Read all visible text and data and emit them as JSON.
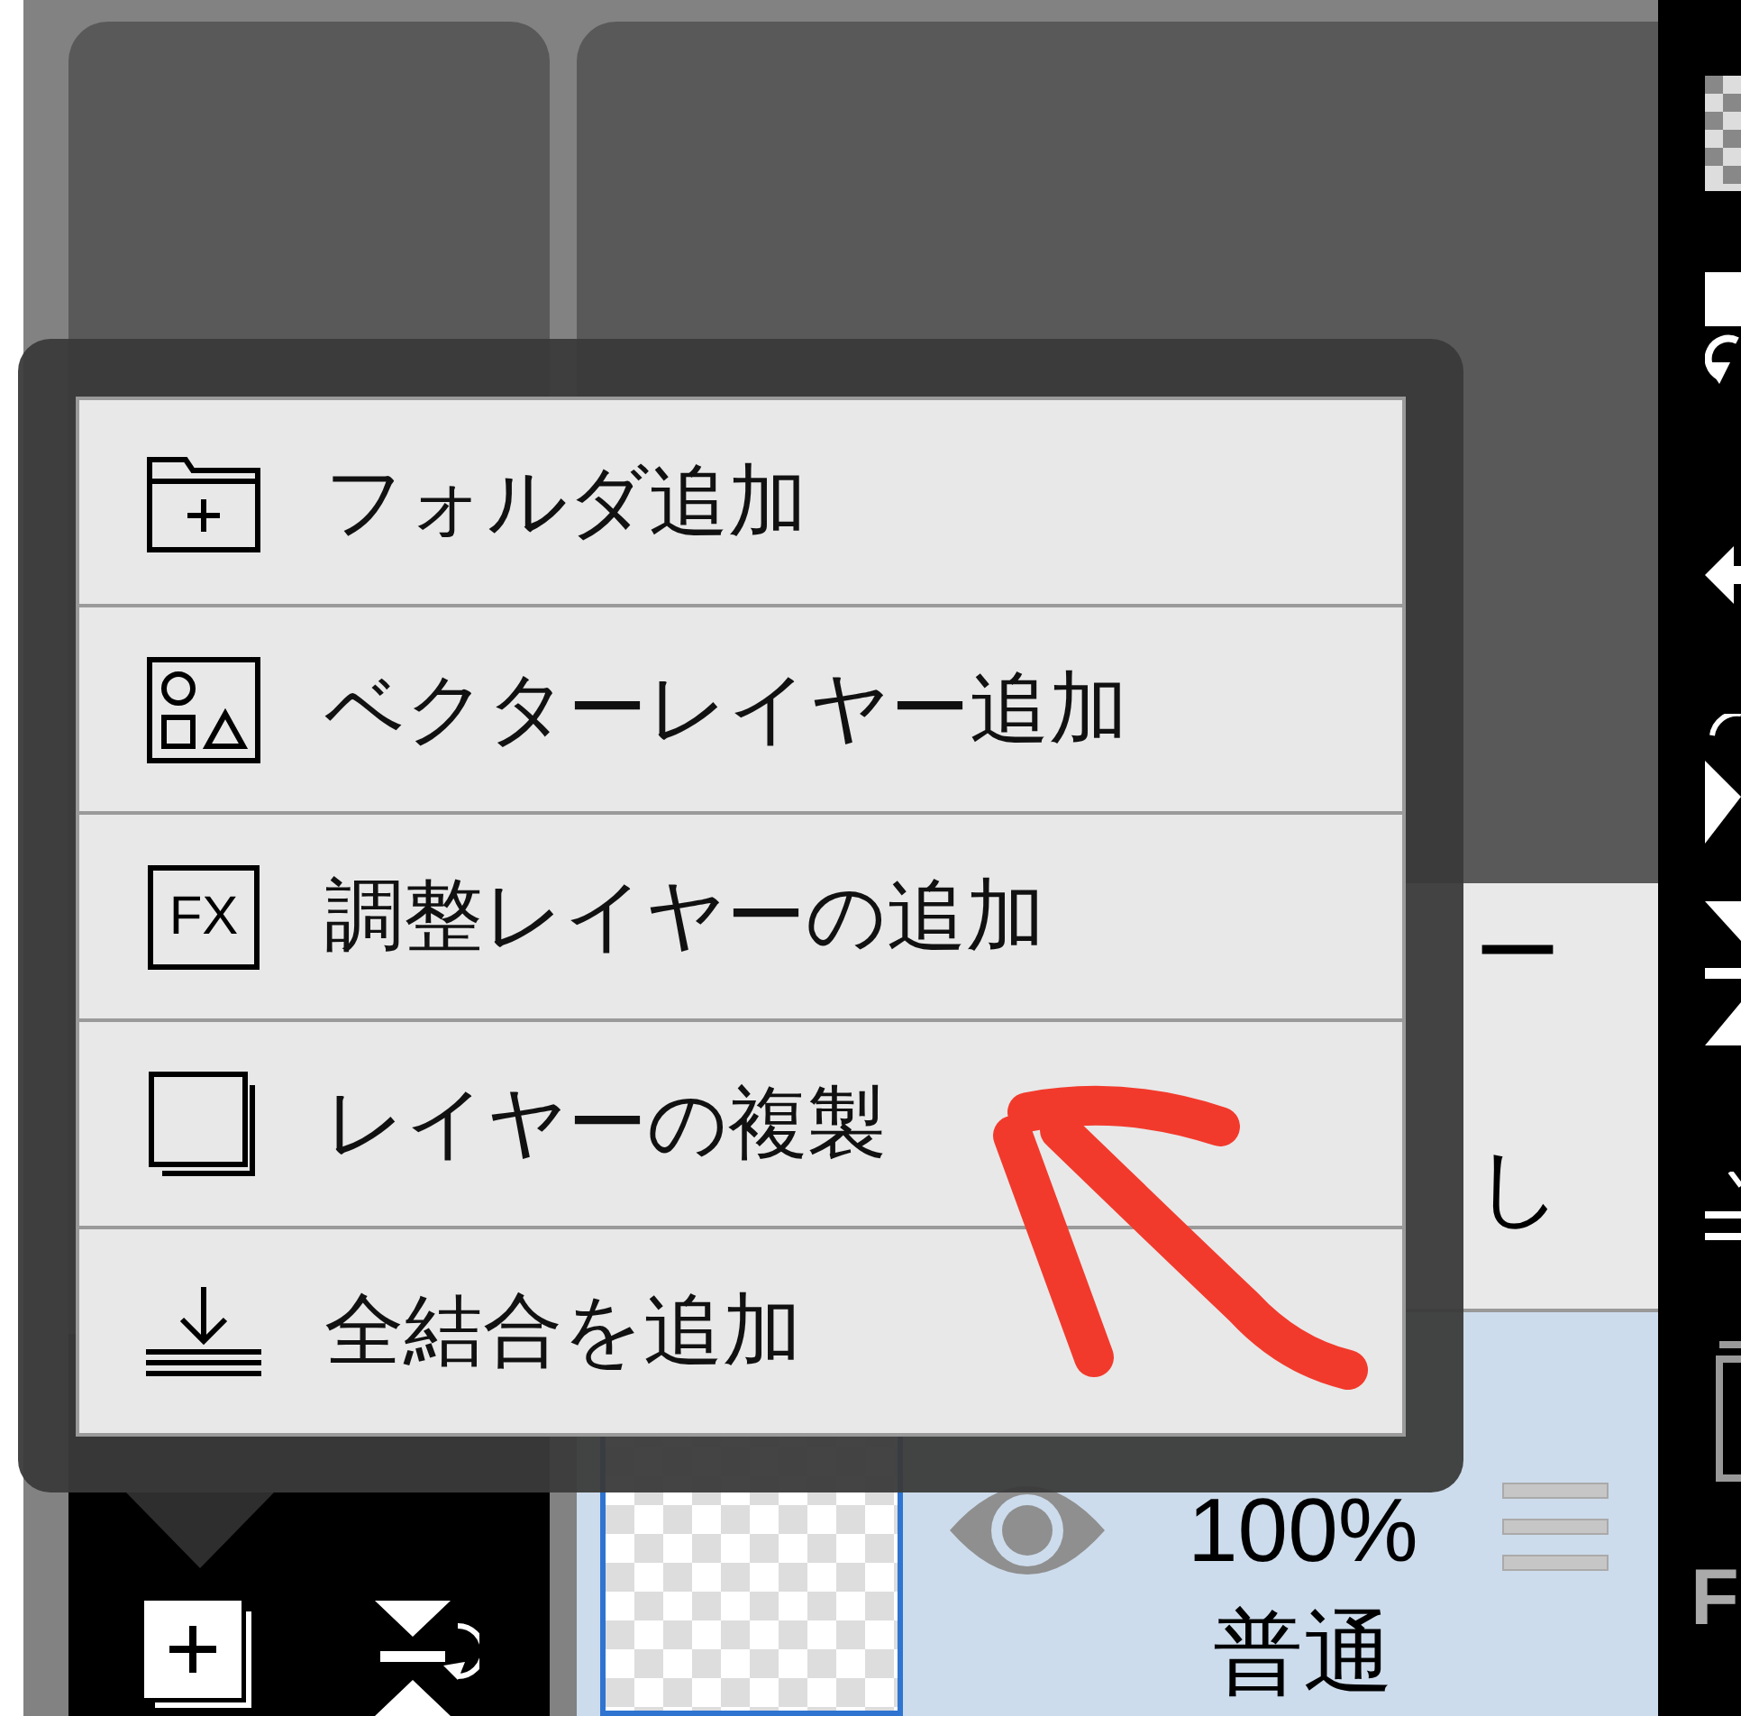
{
  "menu": {
    "items": [
      {
        "kind": "folder",
        "label": "フォルダ追加"
      },
      {
        "kind": "vector",
        "label": "ベクターレイヤー追加"
      },
      {
        "kind": "adjust",
        "icon_text": "FX",
        "label": "調整レイヤーの追加"
      },
      {
        "kind": "duplicate",
        "label": "レイヤーの複製"
      },
      {
        "kind": "merge",
        "label": "全結合を追加"
      }
    ]
  },
  "layers": [
    {
      "selected": false,
      "name_fragments": [
        "ー",
        "し"
      ]
    },
    {
      "selected": true,
      "visible": true,
      "opacity": "100%",
      "blend": "普通"
    }
  ],
  "right_toolbar": {
    "cut_label": "F"
  }
}
